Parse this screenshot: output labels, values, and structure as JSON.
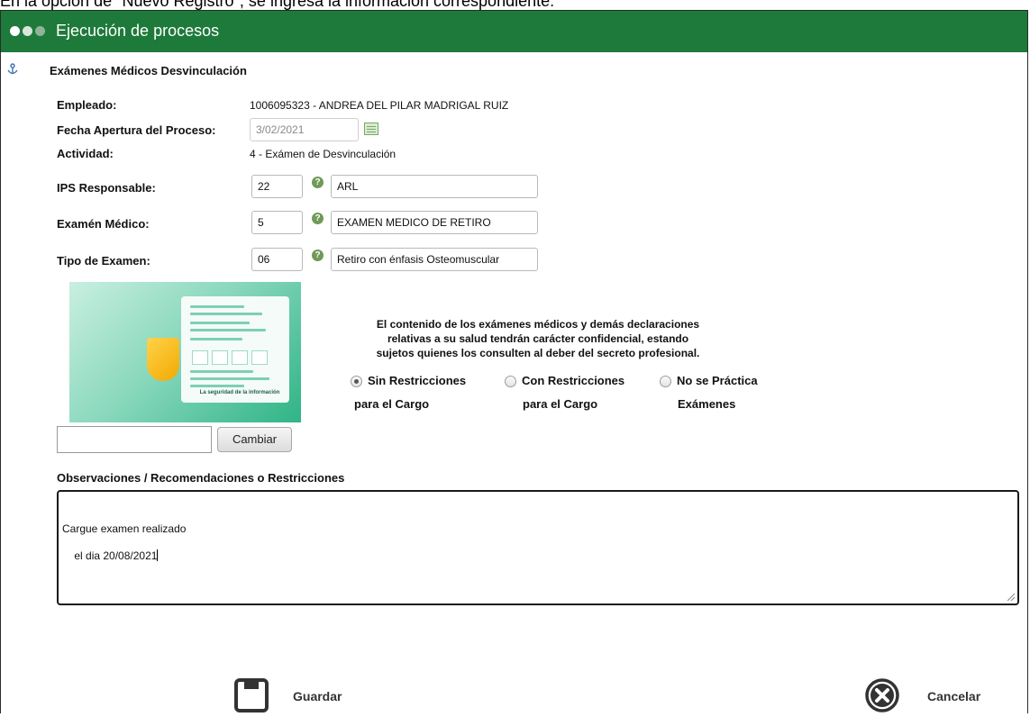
{
  "caption": "En la opción de \"Nuevo Registro\", se ingresa la información correspondiente:",
  "window": {
    "title": "Ejecución de procesos"
  },
  "section": {
    "title": "Exámenes Médicos Desvinculación"
  },
  "fields": {
    "empleado_label": "Empleado:",
    "empleado_value": "1006095323 - ANDREA DEL PILAR MADRIGAL RUIZ",
    "fecha_label": "Fecha Apertura del Proceso:",
    "fecha_value": "3/02/2021",
    "actividad_label": "Actividad:",
    "actividad_value": "4 - Exámen de Desvinculación",
    "ips_label": "IPS Responsable:",
    "ips_code": "22",
    "ips_name": "ARL",
    "examen_label": "Examén Médico:",
    "examen_code": "5",
    "examen_name": "EXAMEN MEDICO DE RETIRO",
    "tipo_label": "Tipo de Examen:",
    "tipo_code": "06",
    "tipo_name": "Retiro con énfasis Osteomuscular"
  },
  "promo": {
    "caption": "La seguridad de la información"
  },
  "file": {
    "value": "",
    "change_label": "Cambiar"
  },
  "notice": {
    "line1": "El contenido de los exámenes médicos y demás declaraciones",
    "line2": "relativas a su salud tendrán carácter confidencial, estando",
    "line3": "sujetos quienes los consulten al deber del secreto profesional."
  },
  "options": [
    {
      "line1": "Sin Restricciones",
      "line2": "para el Cargo",
      "checked": true
    },
    {
      "line1": "Con Restricciones",
      "line2": "para el Cargo",
      "checked": false
    },
    {
      "line1": "No se Práctica",
      "line2": "Exámenes",
      "checked": false
    }
  ],
  "observations": {
    "label": "Observaciones / Recomendaciones o Restricciones",
    "line1": "Cargue examen realizado",
    "line2": "el dia 20/08/2021"
  },
  "actions": {
    "save_label": "Guardar",
    "cancel_label": "Cancelar"
  },
  "colors": {
    "titlebar": "#1e7a3a",
    "help_icon": "#6f9a57"
  }
}
